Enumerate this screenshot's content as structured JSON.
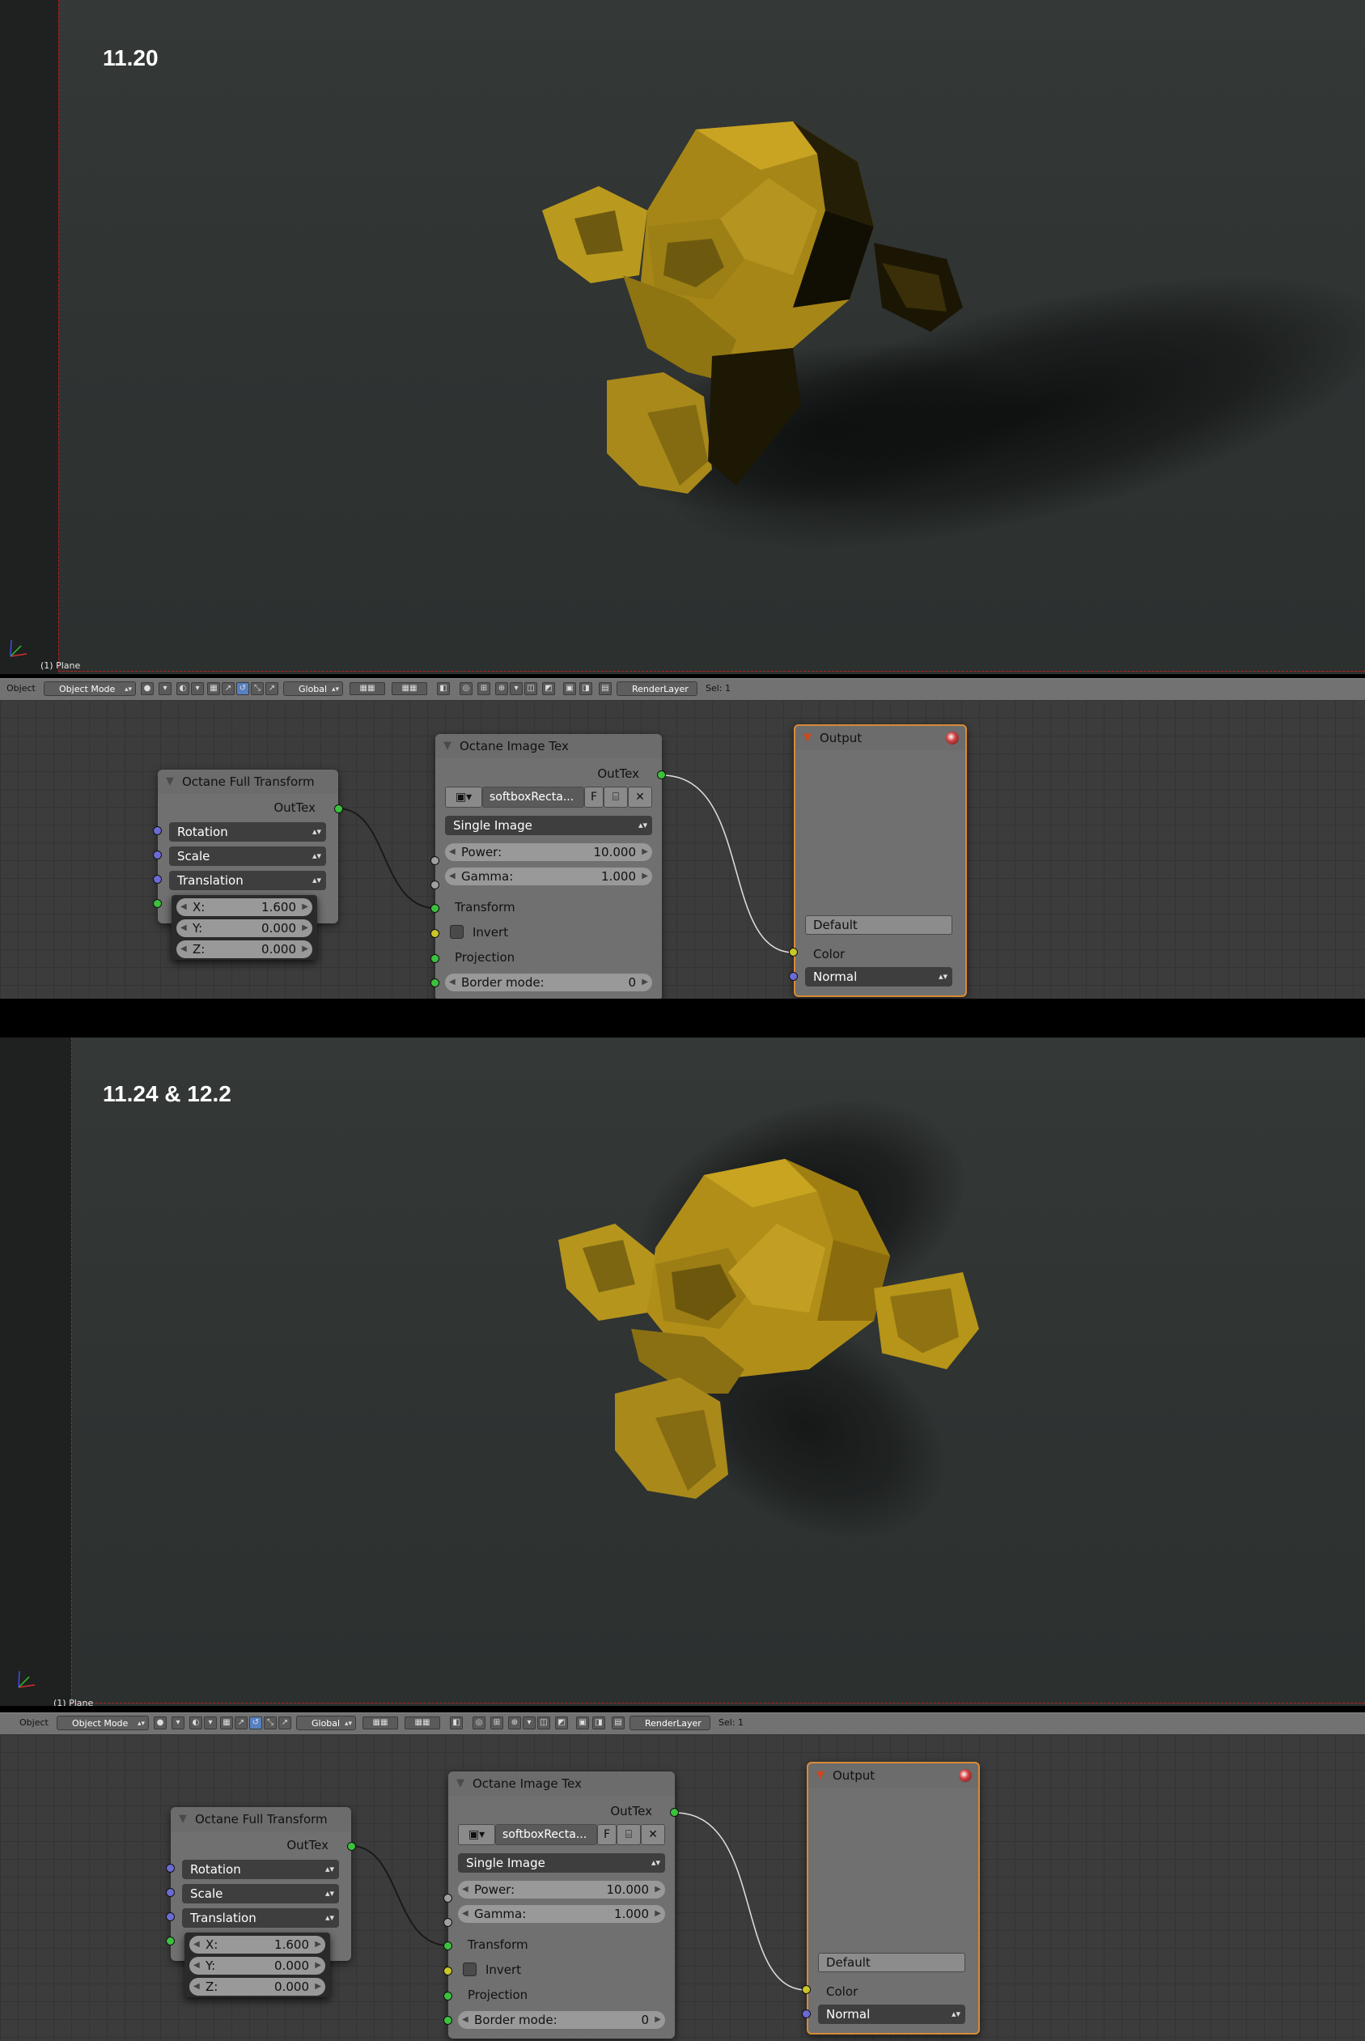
{
  "panels": [
    {
      "label": "11.20",
      "plane_label": "(1) Plane",
      "header": {
        "object_menu": "Object",
        "mode": "Object Mode",
        "orientation": "Global",
        "render_layer": "RenderLayer",
        "sel": "Sel: 1"
      },
      "transform_node": {
        "title": "Octane Full Transform",
        "out": "OutTex",
        "rows": [
          "Rotation",
          "Scale",
          "Translation"
        ],
        "popup": [
          {
            "k": "X:",
            "v": "1.600"
          },
          {
            "k": "Y:",
            "v": "0.000"
          },
          {
            "k": "Z:",
            "v": "0.000"
          }
        ]
      },
      "image_node": {
        "title": "Octane Image Tex",
        "out": "OutTex",
        "image_name": "softboxRecta...",
        "f_button": "F",
        "mode": "Single Image",
        "power_label": "Power:",
        "power_value": "10.000",
        "gamma_label": "Gamma:",
        "gamma_value": "1.000",
        "transform": "Transform",
        "invert": "Invert",
        "projection": "Projection",
        "border_label": "Border mode:",
        "border_value": "0"
      },
      "output_node": {
        "title": "Output",
        "default_field": "Default",
        "color": "Color",
        "normal": "Normal"
      }
    },
    {
      "label": "11.24 & 12.2",
      "plane_label": "(1) Plane",
      "header": {
        "object_menu": "Object",
        "mode": "Object Mode",
        "orientation": "Global",
        "render_layer": "RenderLayer",
        "sel": "Sel: 1"
      },
      "transform_node": {
        "title": "Octane Full Transform",
        "out": "OutTex",
        "rows": [
          "Rotation",
          "Scale",
          "Translation"
        ],
        "popup": [
          {
            "k": "X:",
            "v": "1.600"
          },
          {
            "k": "Y:",
            "v": "0.000"
          },
          {
            "k": "Z:",
            "v": "0.000"
          }
        ]
      },
      "image_node": {
        "title": "Octane Image Tex",
        "out": "OutTex",
        "image_name": "softboxRecta...",
        "f_button": "F",
        "mode": "Single Image",
        "power_label": "Power:",
        "power_value": "10.000",
        "gamma_label": "Gamma:",
        "gamma_value": "1.000",
        "transform": "Transform",
        "invert": "Invert",
        "projection": "Projection",
        "border_label": "Border mode:",
        "border_value": "0"
      },
      "output_node": {
        "title": "Output",
        "default_field": "Default",
        "color": "Color",
        "normal": "Normal"
      }
    }
  ],
  "colors": {
    "monkey": "#b8961a",
    "socket_green": "#3cc13c",
    "socket_blue": "#6b6bd6",
    "socket_yellow": "#c8c628",
    "output_border": "#d98a36"
  }
}
